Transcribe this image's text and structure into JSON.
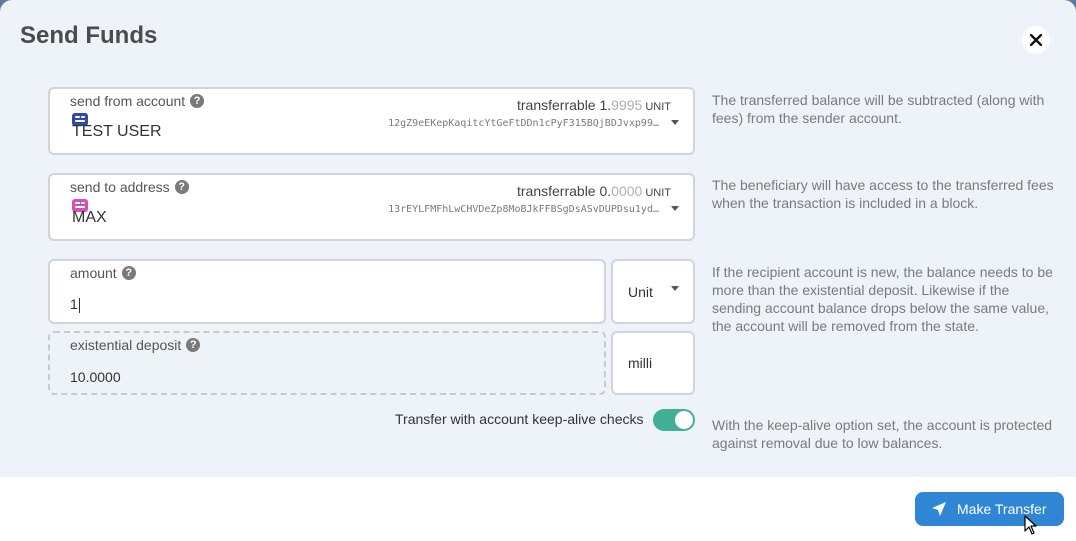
{
  "modal": {
    "title": "Send Funds"
  },
  "from": {
    "label": "send from account",
    "transferrable_prefix": "transferrable 1.",
    "transferrable_fraction": "9995",
    "unit": "UNIT",
    "account_name": "TEST USER",
    "address": "12gZ9eEKepKaqitcYtGeFtDDn1cPyF315BQjBDJvxp99…",
    "help_text": "The transferred balance will be subtracted (along with fees) from the sender account.",
    "icon_color": "#2c4aa8"
  },
  "to": {
    "label": "send to address",
    "transferrable_prefix": "transferrable 0.",
    "transferrable_fraction": "0000",
    "unit": "UNIT",
    "account_name": "MAX",
    "address": "13rEYLFMFhLwCHVDeZp8MoBJkFFBSgDsASvDUPDsu1yd…",
    "help_text": "The beneficiary will have access to the transferred fees when the transaction is included in a block.",
    "icon_color": "#d54fb8"
  },
  "amount": {
    "label": "amount",
    "value": "1",
    "unit": "Unit",
    "help_text": "If the recipient account is new, the balance needs to be more than the existential deposit. Likewise if the sending account balance drops below the same value, the account will be removed from the state."
  },
  "existential": {
    "label": "existential deposit",
    "value": "10.0000",
    "unit": "milli"
  },
  "keepalive": {
    "label": "Transfer with account keep-alive checks",
    "enabled": true,
    "help_text": "With the keep-alive option set, the account is protected against removal due to low balances."
  },
  "footer": {
    "button_label": "Make Transfer"
  },
  "colors": {
    "accent": "#2f86d4",
    "toggle": "#41b095"
  }
}
